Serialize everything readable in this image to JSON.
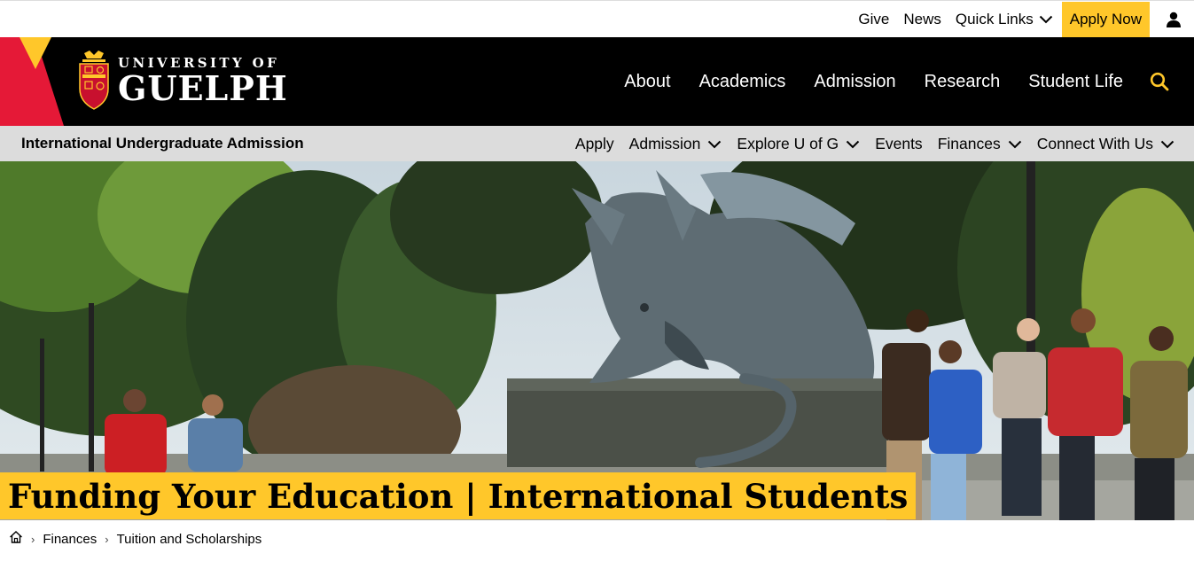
{
  "utility": {
    "give": "Give",
    "news": "News",
    "quick_links": "Quick Links",
    "apply_now": "Apply Now"
  },
  "brand": {
    "line1": "UNIVERSITY OF",
    "line2": "GUELPH",
    "colors": {
      "red": "#e51937",
      "gold": "#ffc72a",
      "black": "#000000"
    }
  },
  "main_nav": [
    "About",
    "Academics",
    "Admission",
    "Research",
    "Student Life"
  ],
  "sub_nav": {
    "title": "International Undergraduate Admission",
    "items": [
      {
        "label": "Apply",
        "dropdown": false
      },
      {
        "label": "Admission",
        "dropdown": true
      },
      {
        "label": "Explore U of G",
        "dropdown": true
      },
      {
        "label": "Events",
        "dropdown": false
      },
      {
        "label": "Finances",
        "dropdown": true
      },
      {
        "label": "Connect With Us",
        "dropdown": true
      }
    ]
  },
  "hero": {
    "title": "Funding Your Education | International Students"
  },
  "breadcrumb": {
    "home_icon": "home-icon",
    "items": [
      "Finances",
      "Tuition and Scholarships"
    ]
  }
}
